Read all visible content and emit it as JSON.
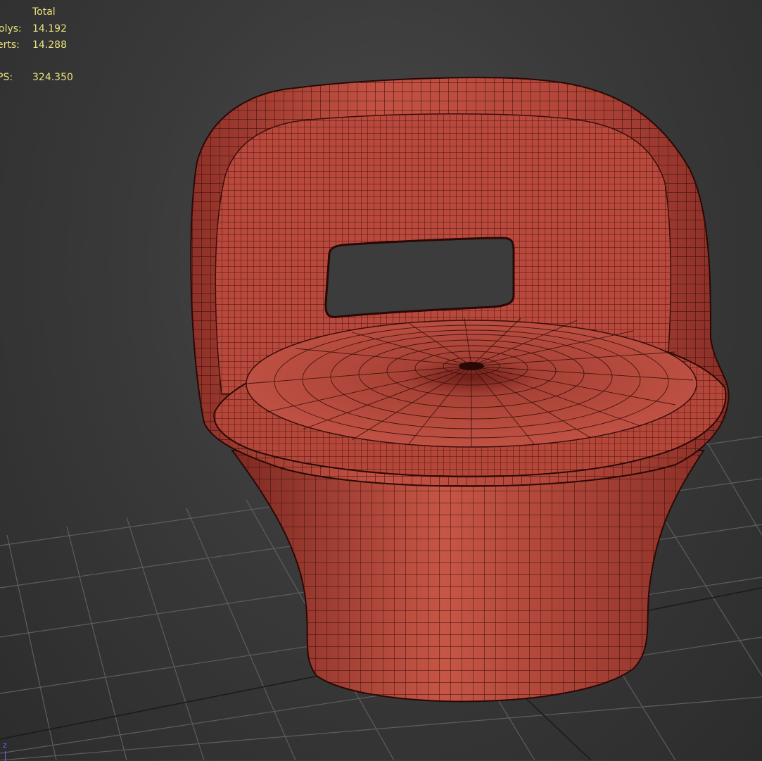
{
  "viewport_stats": {
    "header": "Total",
    "rows": [
      {
        "label": "olys:",
        "value": "14.192"
      },
      {
        "label": "erts:",
        "value": "14.288"
      },
      {
        "label": "PS:",
        "value": "324.350"
      }
    ]
  },
  "gizmo": {
    "axis_label": "z",
    "axis_color": "#5a6dff"
  },
  "colors": {
    "stats_text": "#e8e07c",
    "background": "#3a3a3a",
    "grid": "#5e5e5e",
    "model_fill": "#b84a3d",
    "wireframe": "#3a0e0a"
  },
  "scene": {
    "object": "round armchair mesh with wireframe overlay",
    "grid_visible": true
  }
}
